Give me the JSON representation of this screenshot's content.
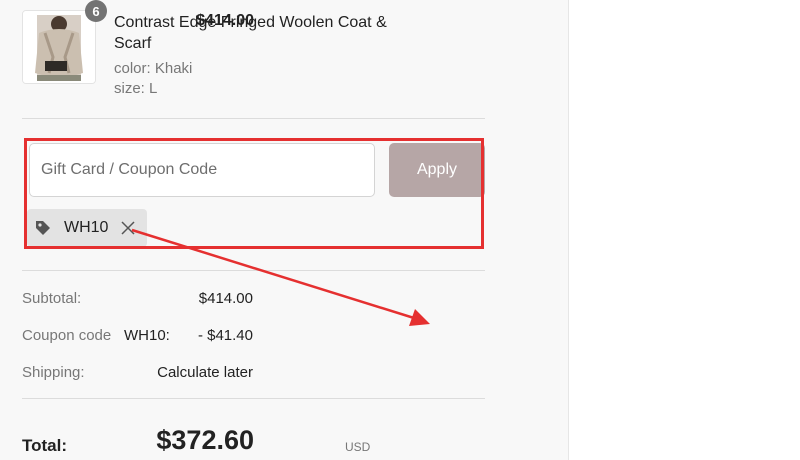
{
  "item": {
    "quantity": "6",
    "name": "Contrast Edge Fringed Woolen Coat & Scarf",
    "color": "color: Khaki",
    "size": "size: L",
    "price": "$414.00"
  },
  "coupon": {
    "placeholder": "Gift Card / Coupon Code",
    "apply_label": "Apply",
    "applied_code": "WH10"
  },
  "summary": {
    "subtotal_label": "Subtotal:",
    "subtotal_value": "$414.00",
    "coupon_label": "Coupon code",
    "coupon_code": "WH10:",
    "coupon_value": "- $41.40",
    "shipping_label": "Shipping:",
    "shipping_value": "Calculate later",
    "total_label": "Total:",
    "currency": "USD",
    "total_value": "$372.60"
  },
  "colors": {
    "annotation": "#e53030",
    "apply_button": "#b6a6a6",
    "badge": "#737373"
  },
  "icons": {
    "tag": "tag-icon",
    "remove": "close-icon"
  }
}
